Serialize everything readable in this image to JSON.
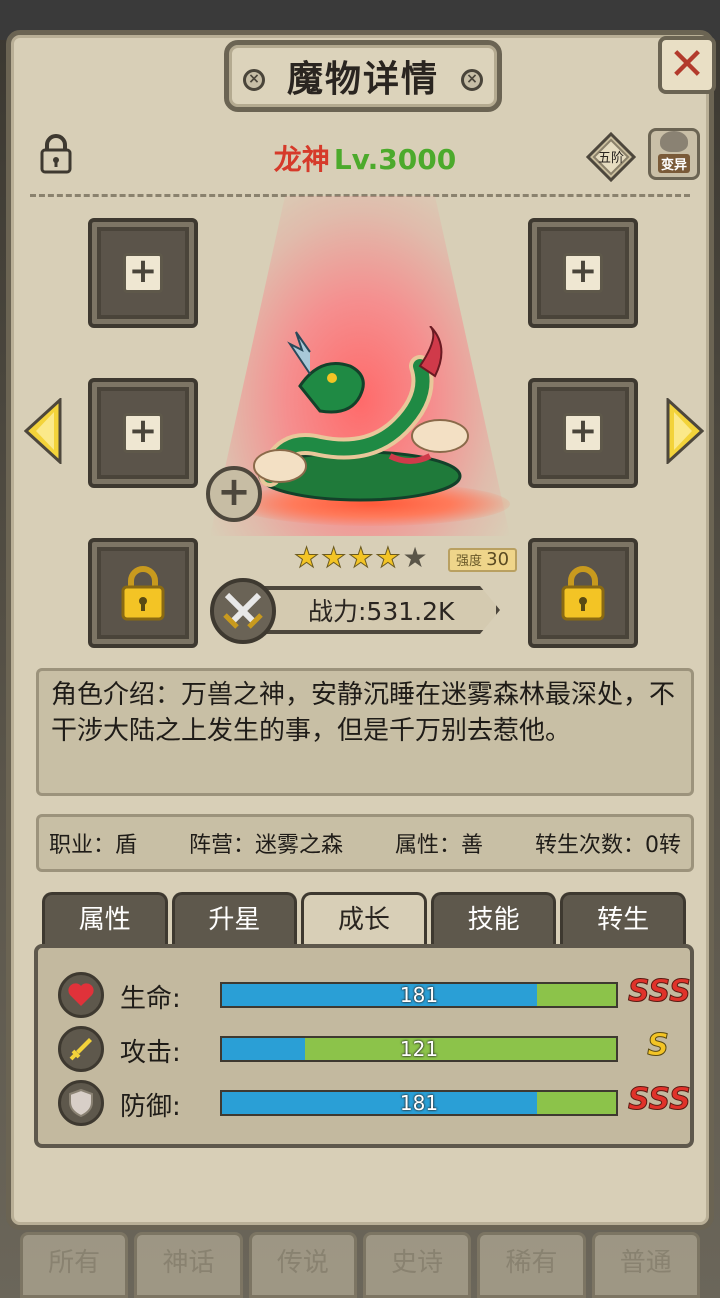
{
  "window": {
    "title": "魔物详情"
  },
  "monster": {
    "name": "龙神",
    "level": "Lv.3000",
    "rank_badge": "五阶",
    "mutate_label": "变异",
    "stars_filled": 4,
    "stars_total": 5,
    "strength_label": "强度",
    "strength_value": "30",
    "power_text": "战力:531.2K"
  },
  "description": "角色介绍：万兽之神，安静沉睡在迷雾森林最深处，不干涉大陆之上发生的事，但是千万别去惹他。",
  "info": {
    "job": "职业：盾",
    "camp": "阵营：迷雾之森",
    "attribute": "属性：善",
    "rebirth": "转生次数：0转"
  },
  "tabs": [
    {
      "label": "属性",
      "active": false
    },
    {
      "label": "升星",
      "active": false
    },
    {
      "label": "成长",
      "active": true
    },
    {
      "label": "技能",
      "active": false
    },
    {
      "label": "转生",
      "active": false
    }
  ],
  "stats": [
    {
      "label": "生命:",
      "value": "181",
      "fill": 0.8,
      "grade": "SSS",
      "icon": "heart-icon"
    },
    {
      "label": "攻击:",
      "value": "121",
      "fill": 0.21,
      "grade": "S",
      "icon": "sword-icon"
    },
    {
      "label": "防御:",
      "value": "181",
      "fill": 0.8,
      "grade": "SSS",
      "icon": "shield-icon"
    }
  ],
  "background_tabs": [
    "所有",
    "神话",
    "传说",
    "史诗",
    "稀有",
    "普通"
  ],
  "colors": {
    "name": "#d63a2a",
    "level": "#4caa2c",
    "bar_blue": "#2a9fd6",
    "bar_green": "#8cc34a",
    "grade_sss": "#e0322a",
    "grade_s": "#f3c425"
  }
}
